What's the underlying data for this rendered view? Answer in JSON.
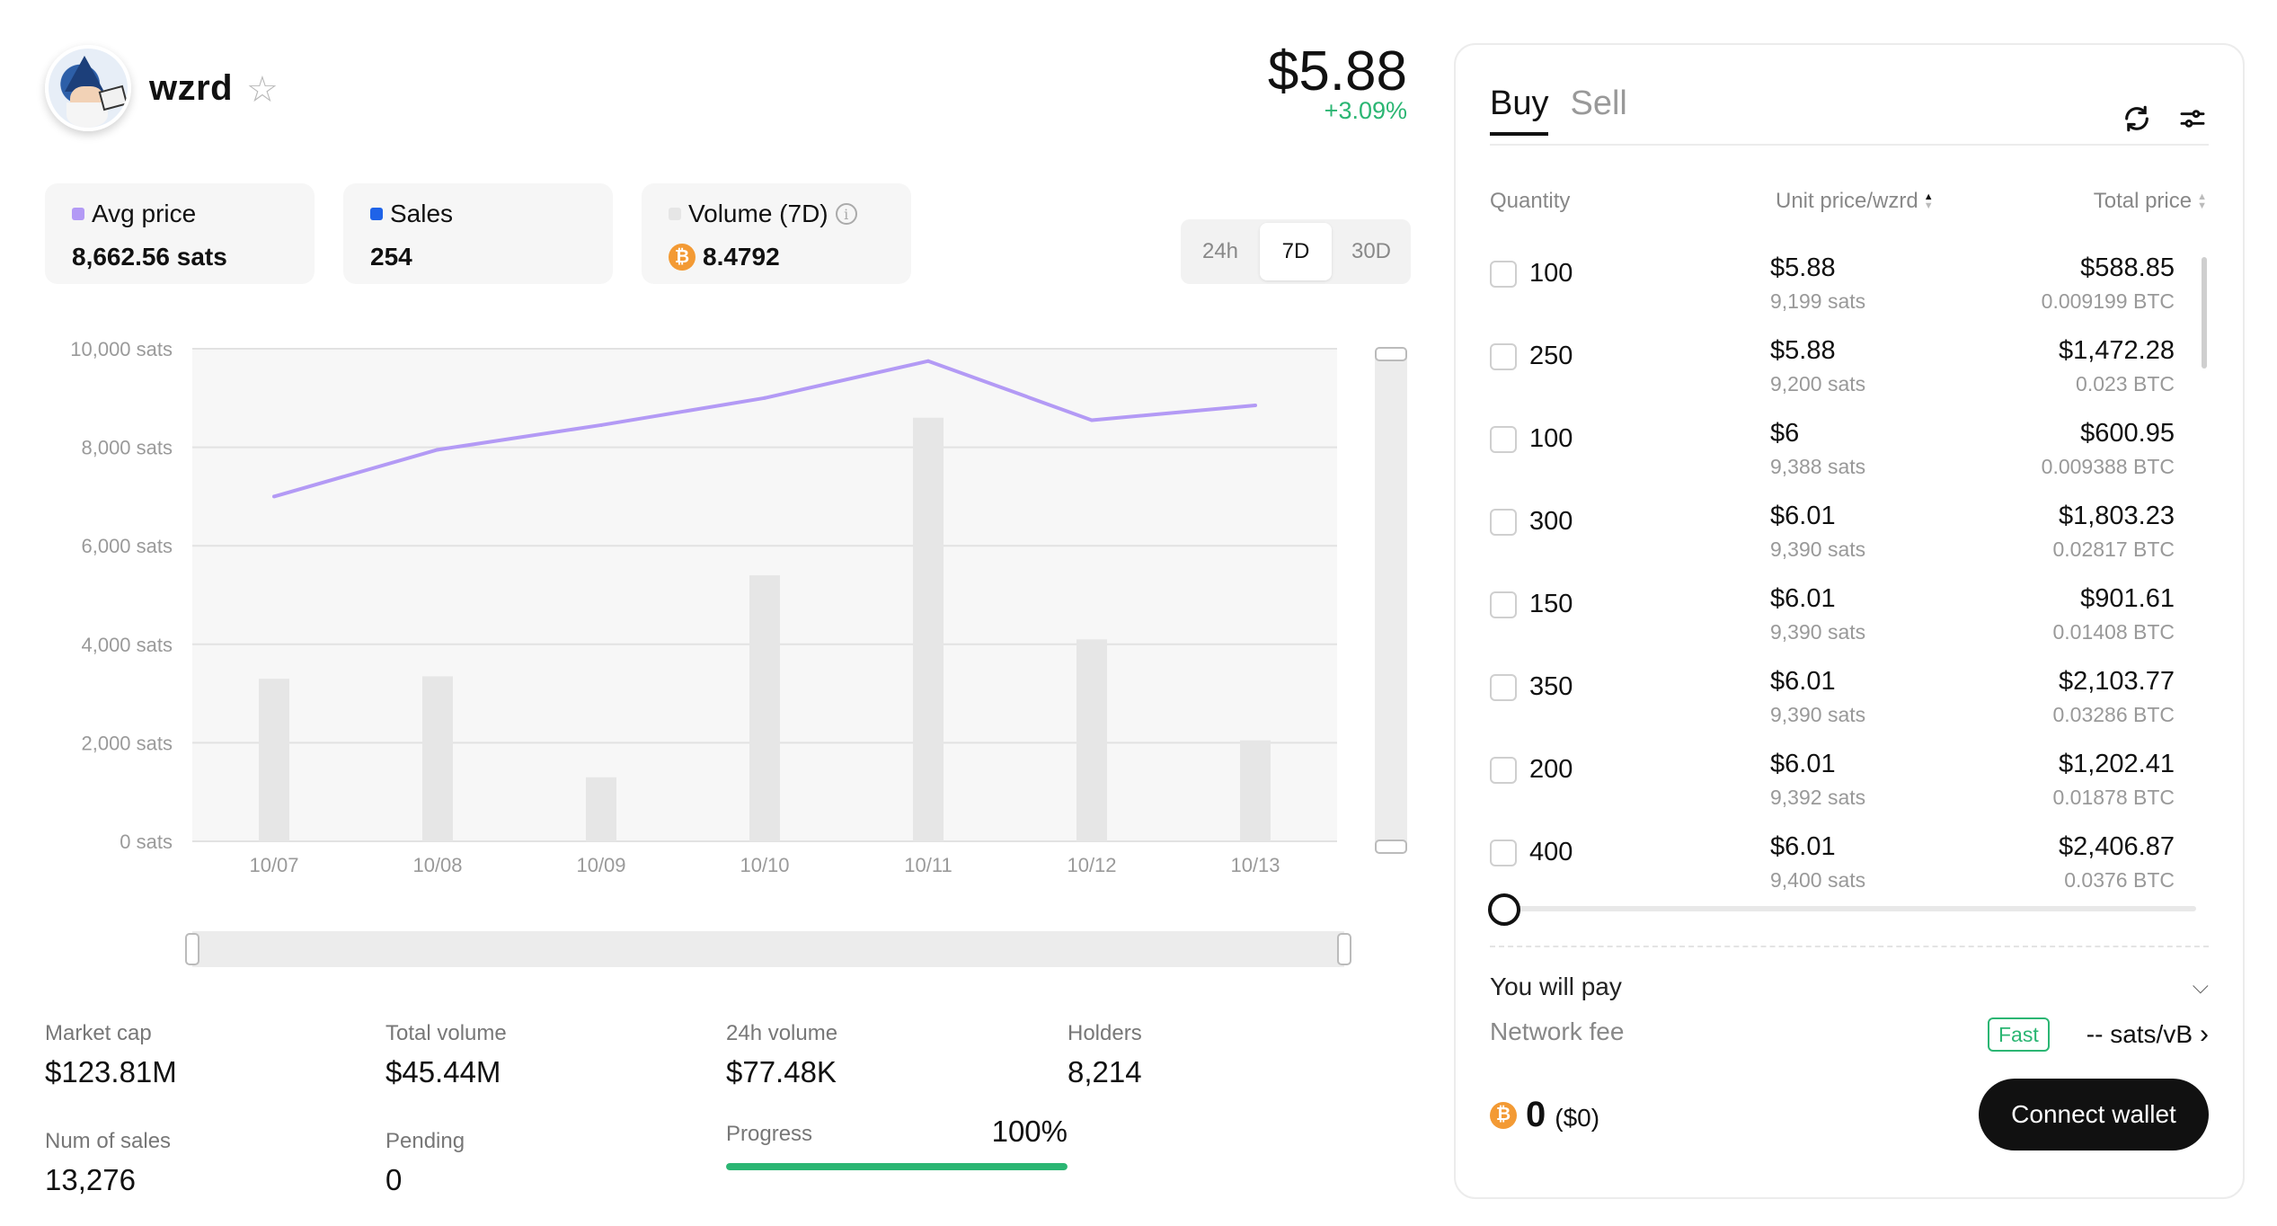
{
  "header": {
    "collection_name": "wzrd",
    "price": "$5.88",
    "price_change": "+3.09%"
  },
  "stats": [
    {
      "label": "Avg price",
      "value": "8,662.56 sats",
      "color": "#b39af5"
    },
    {
      "label": "Sales",
      "value": "254",
      "color": "#1f63e8"
    },
    {
      "label": "Volume (7D)",
      "value": "8.4792",
      "color": "#e6e6e6"
    }
  ],
  "range_tabs": [
    "24h",
    "7D",
    "30D"
  ],
  "range_active": "7D",
  "chart_data": {
    "type": "bar+line",
    "categories": [
      "10/07",
      "10/08",
      "10/09",
      "10/10",
      "10/11",
      "10/12",
      "10/13"
    ],
    "series": [
      {
        "name": "Avg price",
        "kind": "line",
        "color": "#b39af5",
        "values": [
          7000,
          7950,
          8450,
          9000,
          9750,
          8550,
          8850
        ]
      },
      {
        "name": "Sales",
        "kind": "bar",
        "color": "#e6e6e6",
        "values": [
          3300,
          3350,
          1300,
          5400,
          8600,
          4100,
          2050
        ]
      }
    ],
    "yticks": [
      "10,000 sats",
      "8,000 sats",
      "6,000 sats",
      "4,000 sats",
      "2,000 sats",
      "0 sats"
    ],
    "ylim": [
      0,
      10000
    ],
    "grid": true
  },
  "bottom_stats": {
    "market_cap": {
      "label": "Market cap",
      "value": "$123.81M"
    },
    "total_volume": {
      "label": "Total volume",
      "value": "$45.44M"
    },
    "volume_24h": {
      "label": "24h volume",
      "value": "$77.48K"
    },
    "holders": {
      "label": "Holders",
      "value": "8,214"
    },
    "num_sales": {
      "label": "Num of sales",
      "value": "13,276"
    },
    "pending": {
      "label": "Pending",
      "value": "0"
    },
    "progress": {
      "label": "Progress",
      "value": "100%",
      "fraction": 1.0
    }
  },
  "panel": {
    "tabs": [
      "Buy",
      "Sell"
    ],
    "active_tab": "Buy",
    "columns": {
      "quantity": "Quantity",
      "unit_price": "Unit price/wzrd",
      "total_price": "Total price"
    },
    "listings": [
      {
        "qty": "100",
        "unit_usd": "$5.88",
        "unit_sats": "9,199 sats",
        "total_usd": "$588.85",
        "total_btc": "0.009199 BTC"
      },
      {
        "qty": "250",
        "unit_usd": "$5.88",
        "unit_sats": "9,200 sats",
        "total_usd": "$1,472.28",
        "total_btc": "0.023 BTC"
      },
      {
        "qty": "100",
        "unit_usd": "$6",
        "unit_sats": "9,388 sats",
        "total_usd": "$600.95",
        "total_btc": "0.009388 BTC"
      },
      {
        "qty": "300",
        "unit_usd": "$6.01",
        "unit_sats": "9,390 sats",
        "total_usd": "$1,803.23",
        "total_btc": "0.02817 BTC"
      },
      {
        "qty": "150",
        "unit_usd": "$6.01",
        "unit_sats": "9,390 sats",
        "total_usd": "$901.61",
        "total_btc": "0.01408 BTC"
      },
      {
        "qty": "350",
        "unit_usd": "$6.01",
        "unit_sats": "9,390 sats",
        "total_usd": "$2,103.77",
        "total_btc": "0.03286 BTC"
      },
      {
        "qty": "200",
        "unit_usd": "$6.01",
        "unit_sats": "9,392 sats",
        "total_usd": "$1,202.41",
        "total_btc": "0.01878 BTC"
      },
      {
        "qty": "400",
        "unit_usd": "$6.01",
        "unit_sats": "9,400 sats",
        "total_usd": "$2,406.87",
        "total_btc": "0.0376 BTC"
      }
    ],
    "you_will_pay": "You will pay",
    "network_fee": "Network fee",
    "fee_speed": "Fast",
    "fee_value": "-- sats/vB",
    "pay_amount": "0",
    "pay_usd": "($0)",
    "connect_wallet": "Connect wallet"
  },
  "icons": {
    "favorite": "star-outline-icon",
    "refresh": "refresh-icon",
    "settings": "sliders-icon",
    "btc": "bitcoin-icon",
    "info": "info-icon"
  }
}
